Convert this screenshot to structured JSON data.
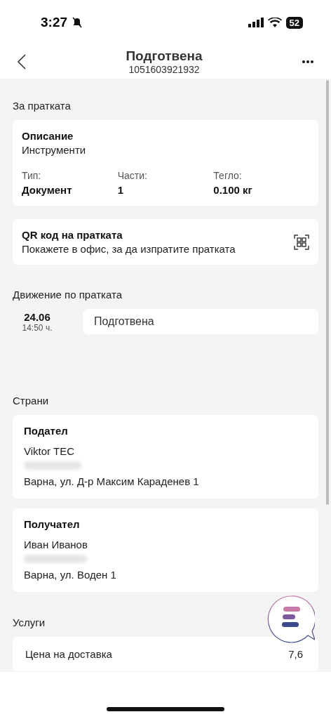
{
  "status_bar": {
    "time": "3:27",
    "battery": "52"
  },
  "header": {
    "title": "Подготвена",
    "subtitle": "1051603921932"
  },
  "shipment": {
    "section": "За пратката",
    "description_label": "Описание",
    "description": "Инструменти",
    "fields": [
      {
        "label": "Тип:",
        "value": "Документ"
      },
      {
        "label": "Части:",
        "value": "1"
      },
      {
        "label": "Тегло:",
        "value": "0.100 кг"
      }
    ]
  },
  "qr": {
    "title": "QR код на пратката",
    "subtitle": "Покажете в офис, за да изпратите пратката"
  },
  "tracking": {
    "section": "Движение по пратката",
    "events": [
      {
        "date": "24.06",
        "time": "14:50 ч.",
        "status": "Подготвена"
      }
    ]
  },
  "parties": {
    "section": "Страни",
    "items": [
      {
        "role": "Подател",
        "name": "Viktor TEC",
        "address": "Варна, ул. Д-р Максим Караденев 1"
      },
      {
        "role": "Получател",
        "name": "Иван Иванов",
        "address": "Варна, ул. Воден 1"
      }
    ]
  },
  "services": {
    "section": "Услуги",
    "rows": [
      {
        "label": "Цена на доставка",
        "value": "7,6"
      }
    ]
  }
}
